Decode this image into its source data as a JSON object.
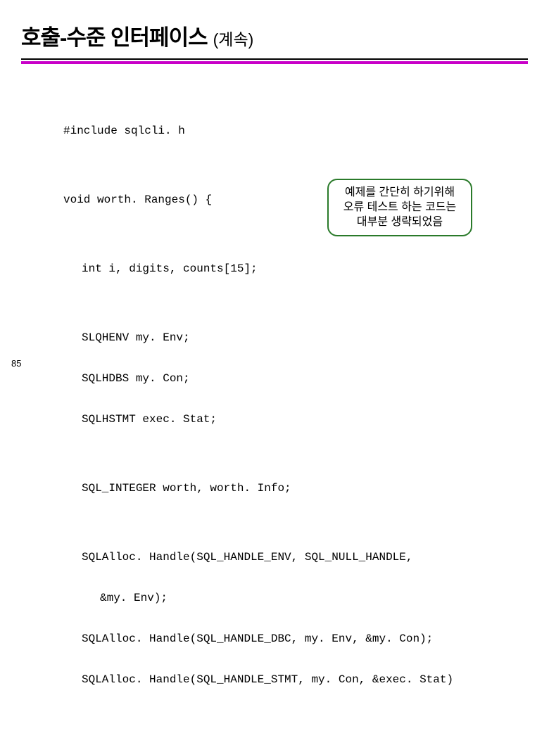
{
  "title": {
    "main": "호출-수준 인터페이스",
    "sub": "(계속)"
  },
  "code": {
    "l1": "#include sqlcli. h",
    "l2": "void worth. Ranges() {",
    "l3": "int i, digits, counts[15];",
    "l4": "SLQHENV my. Env;",
    "l5": "SQLHDBS my. Con;",
    "l6": "SQLHSTMT exec. Stat;",
    "l7": "SQL_INTEGER worth, worth. Info;",
    "l8": "SQLAlloc. Handle(SQL_HANDLE_ENV, SQL_NULL_HANDLE,",
    "l9": "&my. Env);",
    "l10": "SQLAlloc. Handle(SQL_HANDLE_DBC, my. Env, &my. Con);",
    "l11": "SQLAlloc. Handle(SQL_HANDLE_STMT, my. Con, &exec. Stat)"
  },
  "callout": {
    "line1": "예제를 간단히 하기위해",
    "line2": "오류 테스트 하는 코드는",
    "line3": "대부분 생략되었음"
  },
  "page": "85"
}
